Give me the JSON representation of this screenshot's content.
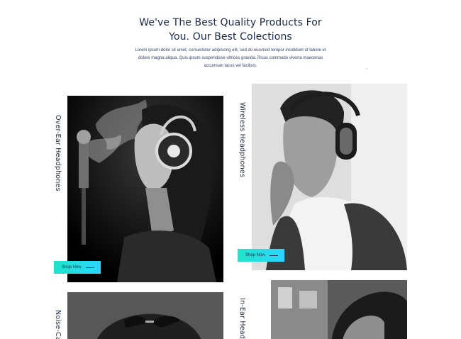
{
  "section": {
    "heading_line1": "We've The Best Quality Products For",
    "heading_line2": "You. Our Best Colections",
    "desc_line1": "Lorem ipsum dolor sit amet, consectetur adipiscing elit, sed do eiusmod tempor incididunt ut labore et",
    "desc_line2": "dolore magna aliqua. Quis ipsum suspendisse ultrices gravida. Risus commodo viverra maecenas",
    "desc_line3": "accumsan lacus vel facilisis."
  },
  "products": [
    {
      "label": "Over-Ear Headphones",
      "button": "Shop Now"
    },
    {
      "label": "Wireless Headphones",
      "button": "Shop Now"
    },
    {
      "label": "Noise-Ca"
    },
    {
      "label": "In-Ear Head"
    }
  ],
  "colors": {
    "heading": "#1b2a4a",
    "accent_start": "#1fe4c9",
    "accent_end": "#2ad6ff"
  },
  "icons": {
    "button_arrow": "arrow-right-line-icon"
  }
}
